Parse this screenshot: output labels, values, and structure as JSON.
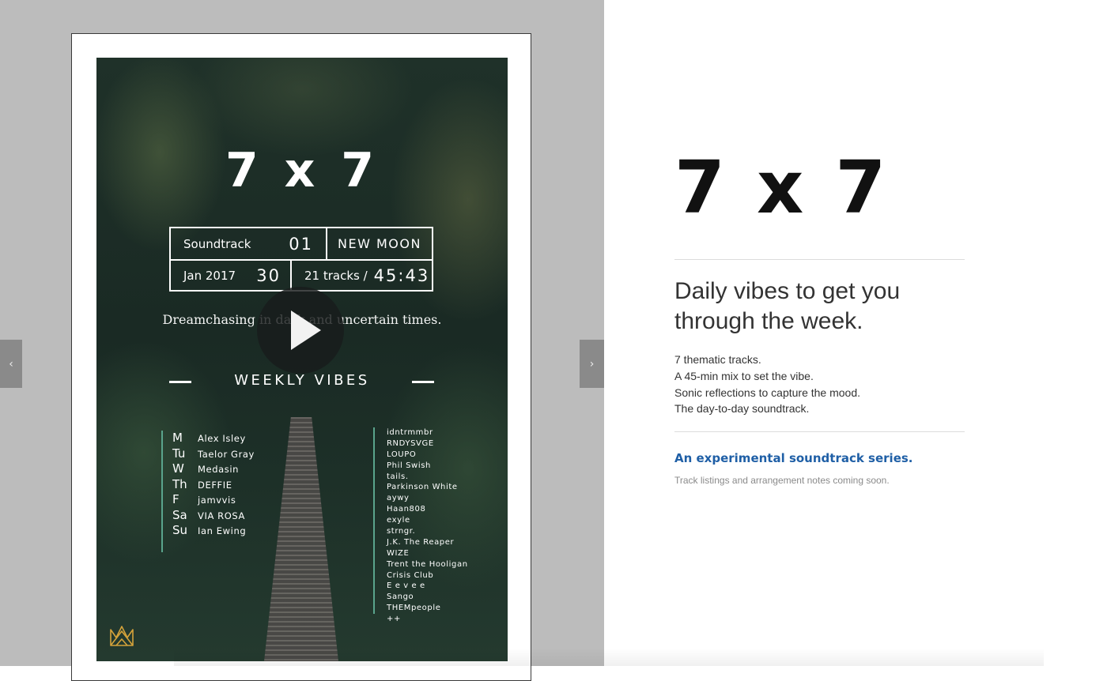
{
  "nav": {
    "prev_glyph": "‹",
    "next_glyph": "›"
  },
  "poster": {
    "title": "7 x 7",
    "soundtrack_label": "Soundtrack",
    "soundtrack_number": "01",
    "moon": "NEW MOON",
    "date_label": "Jan 2017",
    "date_number": "30",
    "tracks_label": "21 tracks  /",
    "duration": "45:43",
    "tagline": "Dreamchasing in dark and uncertain times.",
    "weekly": "WEEKLY  VIBES",
    "days": [
      {
        "key": "M",
        "artist": "Alex Isley"
      },
      {
        "key": "Tu",
        "artist": "Taelor Gray"
      },
      {
        "key": "W",
        "artist": "Medasin"
      },
      {
        "key": "Th",
        "artist": "DEFFIE"
      },
      {
        "key": "F",
        "artist": "jamvvis"
      },
      {
        "key": "Sa",
        "artist": "VIA ROSA"
      },
      {
        "key": "Su",
        "artist": "Ian Ewing"
      }
    ],
    "artists": [
      "idntrmmbr",
      "RNDYSVGE",
      "LOUPO",
      "Phil Swish",
      "tails.",
      "Parkinson White",
      "aywy",
      "Haan808",
      "exyle",
      "strngr.",
      "J.K. The Reaper",
      "WIZE",
      "Trent the Hooligan",
      "Crisis Club",
      "E e v e e",
      "Sango",
      "THEMpeople",
      "++"
    ],
    "logo_icon": "crown-logo-icon",
    "accent": "#5aa48c",
    "logo_color": "#d4a23a"
  },
  "details": {
    "title": "7 x 7",
    "subheading": "Daily vibes to get you through the week.",
    "bullets": [
      "7 thematic tracks.",
      "A 45-min mix to set the vibe.",
      "Sonic reflections to capture the mood.",
      "The day-to-day soundtrack."
    ],
    "series_link": "An experimental soundtrack series.",
    "note": "Track listings and arrangement notes coming soon.",
    "link_color": "#1f5fa6"
  }
}
